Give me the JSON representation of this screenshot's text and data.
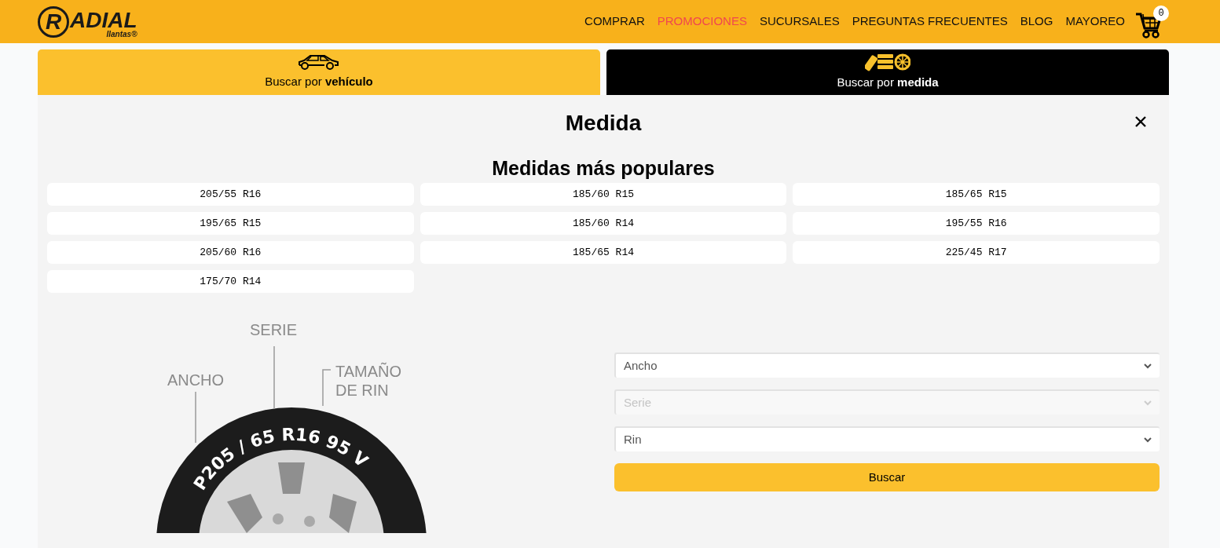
{
  "header": {
    "logo": {
      "mark": "R",
      "name": "ADIAL",
      "tagline": "llantas®"
    },
    "nav": [
      {
        "label": "COMPRAR",
        "highlighted": false
      },
      {
        "label": "PROMOCIONES",
        "highlighted": true
      },
      {
        "label": "SUCURSALES",
        "highlighted": false
      },
      {
        "label": "PREGUNTAS FRECUENTES",
        "highlighted": false
      },
      {
        "label": "BLOG",
        "highlighted": false
      },
      {
        "label": "MAYOREO",
        "highlighted": false
      }
    ],
    "cart_count": "0"
  },
  "tabs": [
    {
      "kind": "vehicle",
      "label": "Buscar por **vehículo**",
      "selected": false
    },
    {
      "kind": "size",
      "label": "Buscar por **medida**",
      "selected": true
    }
  ],
  "panel": {
    "title": "Medida",
    "popular_title": "Medidas más populares",
    "popular_sizes": [
      "205/55 R16",
      "185/60 R15",
      "185/65 R15",
      "195/65 R15",
      "185/60 R14",
      "195/55 R16",
      "205/60 R16",
      "185/65 R14",
      "225/45 R17",
      "175/70 R14"
    ],
    "diagram": {
      "labels": [
        "SERIE",
        "ANCHO",
        "TAMAÑO",
        "DE RIN"
      ],
      "sidewall_text": "P205 / 65 R16 95 V"
    },
    "selects": [
      {
        "placeholder": "Ancho",
        "disabled": false
      },
      {
        "placeholder": "Serie",
        "disabled": true
      },
      {
        "placeholder": "Rin",
        "disabled": false
      }
    ],
    "search_button": "Buscar"
  }
}
